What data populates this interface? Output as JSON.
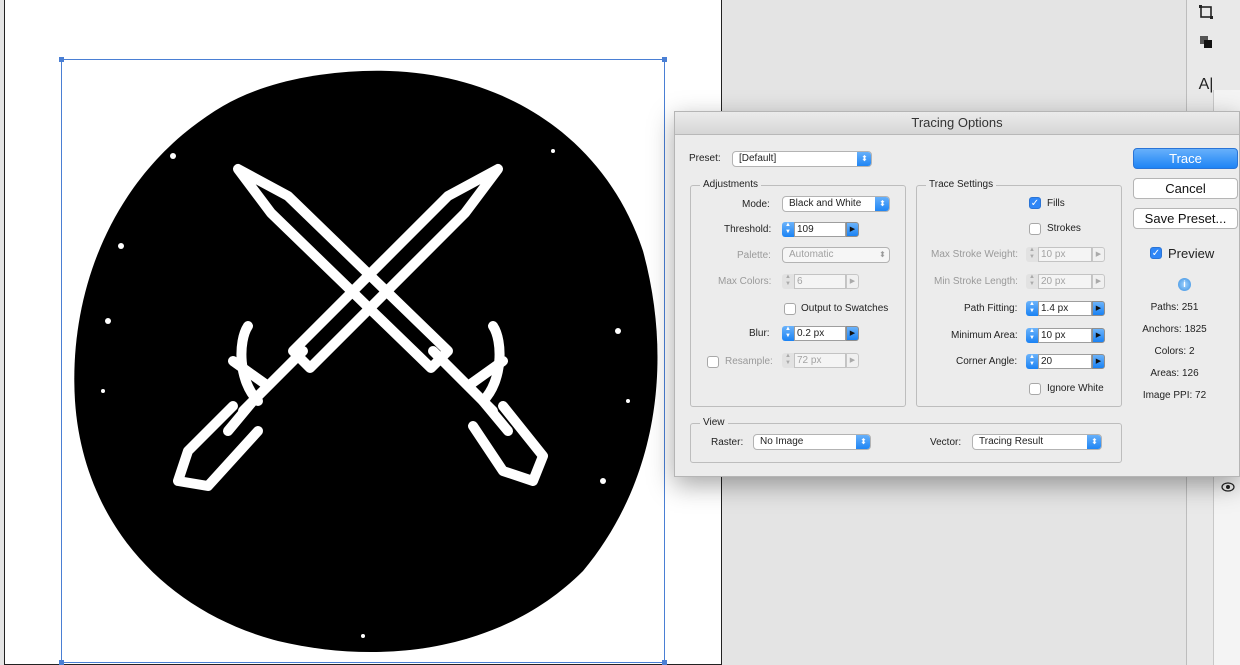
{
  "dialog": {
    "title": "Tracing Options",
    "preset_label": "Preset:",
    "preset_value": "[Default]",
    "adjustments": {
      "title": "Adjustments",
      "mode_label": "Mode:",
      "mode_value": "Black and White",
      "threshold_label": "Threshold:",
      "threshold_value": "109",
      "palette_label": "Palette:",
      "palette_value": "Automatic",
      "max_colors_label": "Max Colors:",
      "max_colors_value": "6",
      "output_swatches_label": "Output to Swatches",
      "blur_label": "Blur:",
      "blur_value": "0.2 px",
      "resample_label": "Resample:",
      "resample_value": "72 px"
    },
    "trace_settings": {
      "title": "Trace Settings",
      "fills_label": "Fills",
      "strokes_label": "Strokes",
      "max_stroke_weight_label": "Max Stroke Weight:",
      "max_stroke_weight_value": "10 px",
      "min_stroke_length_label": "Min Stroke Length:",
      "min_stroke_length_value": "20 px",
      "path_fitting_label": "Path Fitting:",
      "path_fitting_value": "1.4 px",
      "minimum_area_label": "Minimum Area:",
      "minimum_area_value": "10 px",
      "corner_angle_label": "Corner Angle:",
      "corner_angle_value": "20",
      "ignore_white_label": "Ignore White"
    },
    "view": {
      "title": "View",
      "raster_label": "Raster:",
      "raster_value": "No Image",
      "vector_label": "Vector:",
      "vector_value": "Tracing Result"
    },
    "buttons": {
      "trace": "Trace",
      "cancel": "Cancel",
      "save_preset": "Save Preset..."
    },
    "preview_label": "Preview",
    "stats": {
      "paths": "Paths: 251",
      "anchors": "Anchors: 1825",
      "colors": "Colors: 2",
      "areas": "Areas: 126",
      "image_ppi": "Image PPI: 72"
    }
  },
  "colors": {
    "accent": "#1e84f5",
    "selection": "#4a7fd4"
  },
  "icons": [
    "artboard-tool-icon",
    "arrange-icon",
    "type-tool-icon",
    "info-icon",
    "eye-icon"
  ]
}
